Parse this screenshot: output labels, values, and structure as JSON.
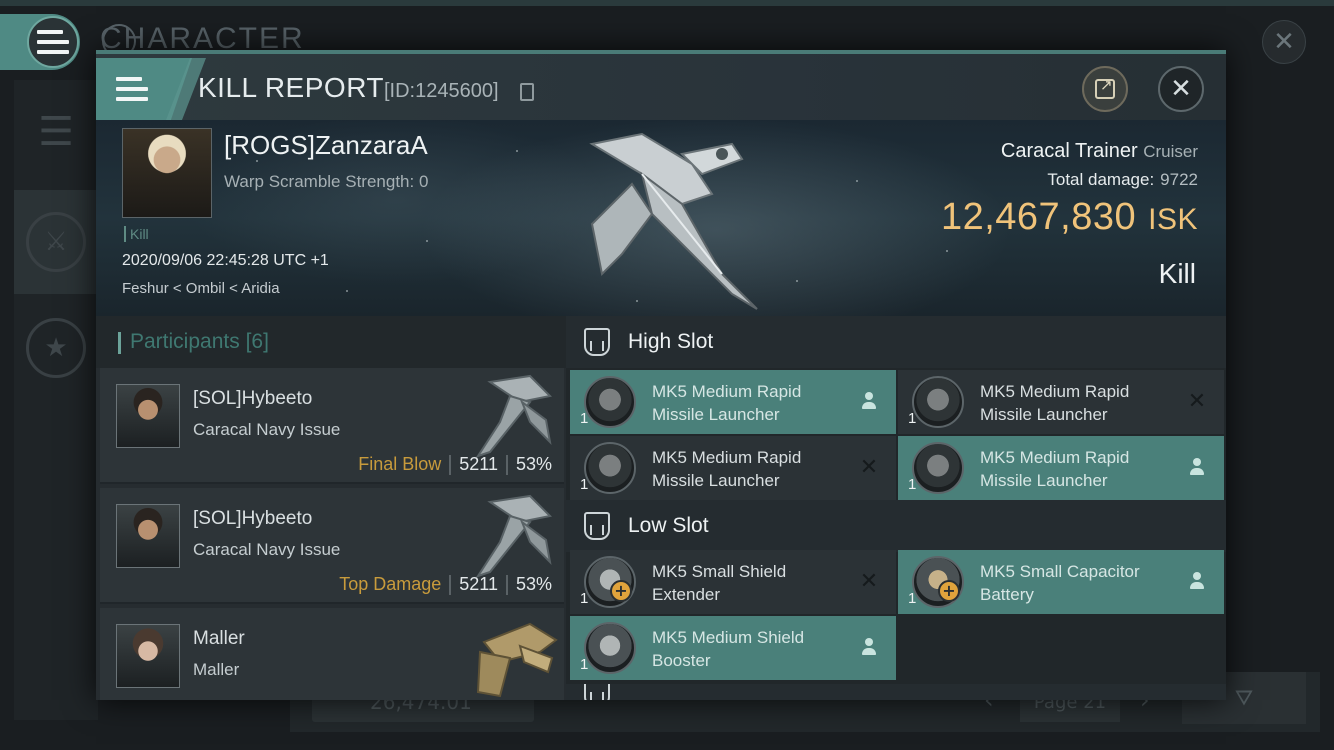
{
  "background": {
    "screen_title": "CHARACTER",
    "isk_value": "26,474.01",
    "page_label": "Page 21"
  },
  "header": {
    "title": "KILL REPORT",
    "report_id": "[ID:1245600]"
  },
  "victim": {
    "name": "[ROGS]ZanzaraA",
    "warp_scramble": "Warp Scramble Strength: 0",
    "kill_tag": "Kill",
    "datetime": "2020/09/06 22:45:28 UTC +1",
    "location": "Feshur < Ombil < Aridia",
    "ship_name": "Caracal Trainer",
    "ship_class": "Cruiser",
    "total_damage_label": "Total damage:",
    "total_damage": "9722",
    "isk_value": "12,467,830",
    "isk_unit": "ISK",
    "result": "Kill"
  },
  "participants": {
    "title": "Participants",
    "count": "[6]",
    "rows": [
      {
        "name": "[SOL]Hybeeto",
        "ship": "Caracal Navy Issue",
        "tag": "Final Blow",
        "damage": "5211",
        "percent": "53%"
      },
      {
        "name": "[SOL]Hybeeto",
        "ship": "Caracal Navy Issue",
        "tag": "Top Damage",
        "damage": "5211",
        "percent": "53%"
      },
      {
        "name": "Maller",
        "ship": "Maller",
        "tag": "",
        "damage": "",
        "percent": ""
      }
    ]
  },
  "fitting": {
    "high_slot_title": "High Slot",
    "low_slot_title": "Low Slot",
    "high_slot": [
      {
        "name": "MK5 Medium Rapid Missile Launcher",
        "qty": "1",
        "status": "fitted",
        "icon": "missile-launcher-icon"
      },
      {
        "name": "MK5 Medium Rapid Missile Launcher",
        "qty": "1",
        "status": "destroyed",
        "icon": "missile-launcher-icon"
      },
      {
        "name": "MK5 Medium Rapid Missile Launcher",
        "qty": "1",
        "status": "destroyed",
        "icon": "missile-launcher-icon"
      },
      {
        "name": "MK5 Medium Rapid Missile Launcher",
        "qty": "1",
        "status": "fitted",
        "icon": "missile-launcher-icon"
      }
    ],
    "low_slot": [
      {
        "name": "MK5 Small Shield Extender",
        "qty": "1",
        "status": "destroyed",
        "icon": "shield-extender-icon"
      },
      {
        "name": "MK5 Small Capacitor Battery",
        "qty": "1",
        "status": "fitted",
        "icon": "capacitor-battery-icon"
      },
      {
        "name": "MK5 Medium Shield Booster",
        "qty": "1",
        "status": "fitted",
        "icon": "shield-booster-icon"
      }
    ]
  },
  "colors": {
    "accent": "#4f8a84",
    "isk": "#f0c37a",
    "final_blow": "#c89b3c"
  }
}
